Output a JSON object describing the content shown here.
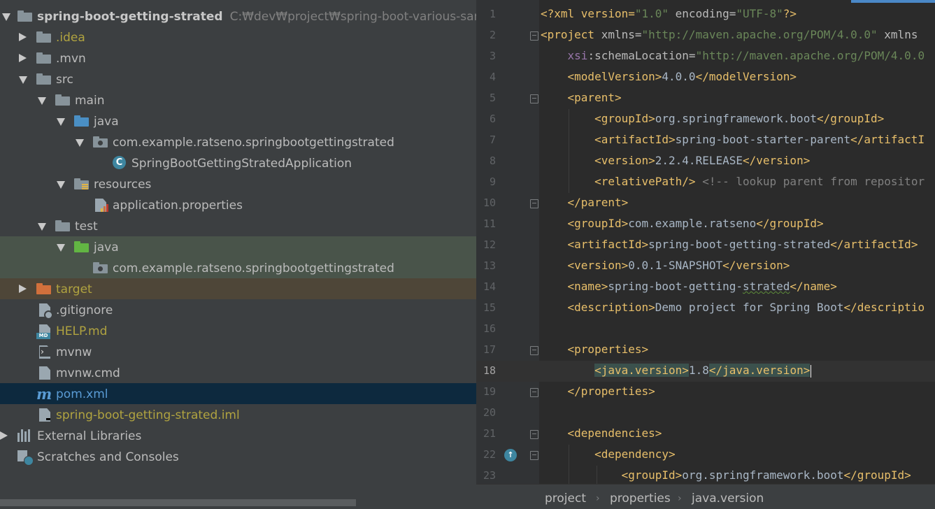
{
  "project_tree": {
    "root": {
      "name": "spring-boot-getting-strated",
      "path": "C:₩dev₩project₩spring-boot-various-sample₩"
    },
    "nodes": [
      {
        "label": ".idea"
      },
      {
        "label": ".mvn"
      },
      {
        "label": "src"
      },
      {
        "label": "main"
      },
      {
        "label": "java"
      },
      {
        "label": "com.example.ratseno.springbootgettingstrated"
      },
      {
        "label": "SpringBootGettingStratedApplication"
      },
      {
        "label": "resources"
      },
      {
        "label": "application.properties"
      },
      {
        "label": "test"
      },
      {
        "label": "java"
      },
      {
        "label": "com.example.ratseno.springbootgettingstrated"
      },
      {
        "label": "target"
      },
      {
        "label": ".gitignore"
      },
      {
        "label": "HELP.md"
      },
      {
        "label": "mvnw"
      },
      {
        "label": "mvnw.cmd"
      },
      {
        "label": "pom.xml"
      },
      {
        "label": "spring-boot-getting-strated.iml"
      },
      {
        "label": "External Libraries"
      },
      {
        "label": "Scratches and Consoles"
      }
    ],
    "colors": {
      "panel_bg": "#3c3f41",
      "selected_bg": "#0d293e",
      "test_bg": "#49544a",
      "excluded_bg": "#4e4638",
      "ignored_text": "#b0a340",
      "default_text": "#bbbbbb"
    }
  },
  "editor": {
    "line_numbers": [
      "1",
      "2",
      "3",
      "4",
      "5",
      "6",
      "7",
      "8",
      "9",
      "10",
      "11",
      "12",
      "13",
      "14",
      "15",
      "16",
      "17",
      "18",
      "19",
      "20",
      "21",
      "22",
      "23"
    ],
    "current_line": "18",
    "text": {
      "xml_decl": "<?xml version=",
      "v_1_0": "\"1.0\"",
      "encoding": " encoding=",
      "utf8": "\"UTF-8\"",
      "decl_end": "?>",
      "project_open": "<project",
      "xmlns_attr": " xmlns=",
      "pom_url": "\"http://maven.apache.org/POM/4.0.0\"",
      "xmlns2": " xmlns",
      "xsi": "xsi",
      "schema_loc": ":schemaLocation=",
      "schema_url": "\"http://maven.apache.org/POM/4.0.0",
      "model_version_open": "<modelVersion>",
      "model_version": "4.0.0",
      "model_version_close": "</modelVersion>",
      "parent_open": "<parent>",
      "group_id_open": "<groupId>",
      "parent_group": "org.springframework.boot",
      "group_id_close": "</groupId>",
      "artifact_id_open": "<artifactId>",
      "parent_artifact": "spring-boot-starter-parent",
      "artifact_cut": "</artifactI",
      "version_open": "<version>",
      "parent_version": "2.2.4.RELEASE",
      "version_close": "</version>",
      "relative_path": "<relativePath/>",
      "comment": " <!-- lookup parent from repositor",
      "parent_close": "</parent>",
      "project_group": "com.example.ratseno",
      "project_artifact": "spring-boot-getting-strated",
      "artifact_id_close": "</artifactId>",
      "project_version": "0.0.1-SNAPSHOT",
      "name_open": "<name>",
      "name_a": "spring-boot-getting-",
      "name_b": "strated",
      "name_close": "</name>",
      "desc_open": "<description>",
      "description": "Demo project for Spring Boot",
      "desc_cut": "</descriptio",
      "properties_open": "<properties>",
      "jv_open_lt": "<",
      "jv_open_rest": "java.version>",
      "java_version": "1.8",
      "jv_close_a": "</java.version",
      "jv_close_gt": ">",
      "properties_close": "</properties>",
      "dependencies_open": "<dependencies>",
      "dependency_open": "<dependency>",
      "dep_group": "org.springframework.boot"
    },
    "breadcrumb": [
      "project",
      "properties",
      "java.version"
    ],
    "colors": {
      "background": "#2b2b2b",
      "gutter": "#313335",
      "tag": "#e8bf6a",
      "string": "#6a8759",
      "comment": "#808080",
      "text": "#a9b7c6"
    }
  }
}
